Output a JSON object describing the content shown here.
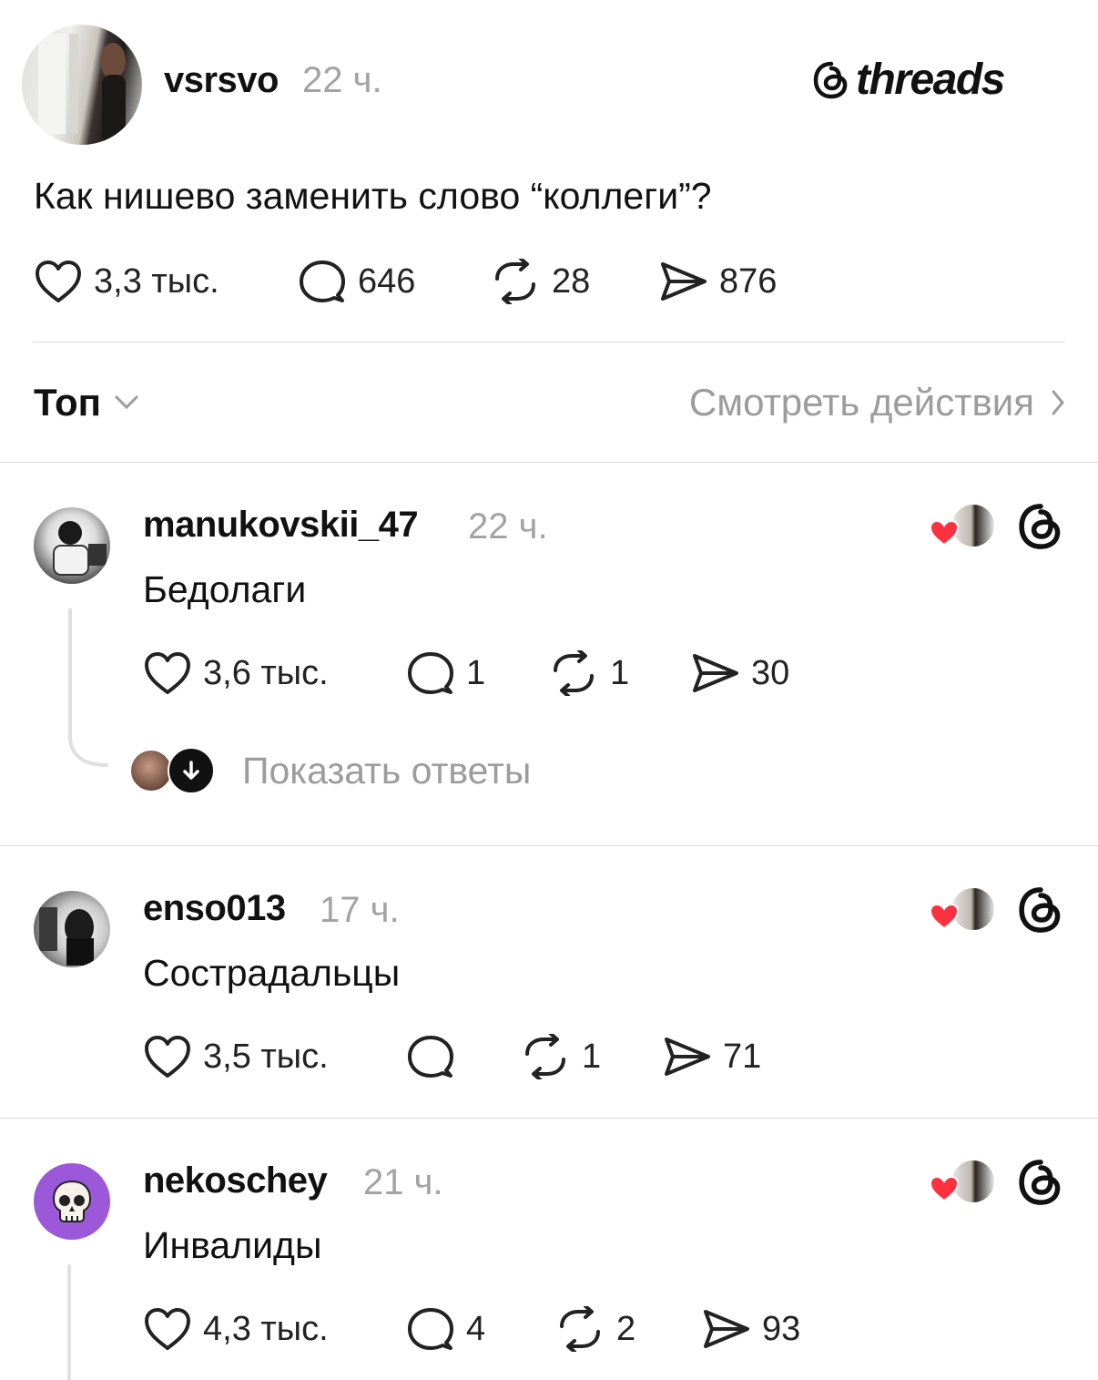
{
  "post": {
    "username": "vsrsvo",
    "time": "22 ч.",
    "brand": "threads",
    "text": "Как нишево заменить слово “коллеги”?",
    "likes": "3,3 тыс.",
    "comments": "646",
    "reposts": "28",
    "shares": "876"
  },
  "filter": {
    "sort_label": "Топ",
    "view_activity": "Смотреть действия"
  },
  "comments": [
    {
      "username": "manukovskii_47",
      "time": "22 ч.",
      "text": "Бедолаги",
      "likes": "3,6 тыс.",
      "comments": "1",
      "reposts": "1",
      "shares": "30",
      "show_replies": "Показать ответы"
    },
    {
      "username": "enso013",
      "time": "17 ч.",
      "text": "Сострадальцы",
      "likes": "3,5 тыс.",
      "comments": "",
      "reposts": "1",
      "shares": "71"
    },
    {
      "username": "nekoschey",
      "time": "21 ч.",
      "text": "Инвалиды",
      "likes": "4,3 тыс.",
      "comments": "4",
      "reposts": "2",
      "shares": "93"
    }
  ],
  "colors": {
    "text": "#111111",
    "muted": "#a3a3a3",
    "like_heart": "#ff3040",
    "skull_avatar_bg": "#9b59d9"
  },
  "icons": [
    "heart-icon",
    "comment-icon",
    "repost-icon",
    "share-icon",
    "threads-logo-icon",
    "chevron-down-icon",
    "chevron-right-icon",
    "arrow-down-icon",
    "skull-icon"
  ]
}
